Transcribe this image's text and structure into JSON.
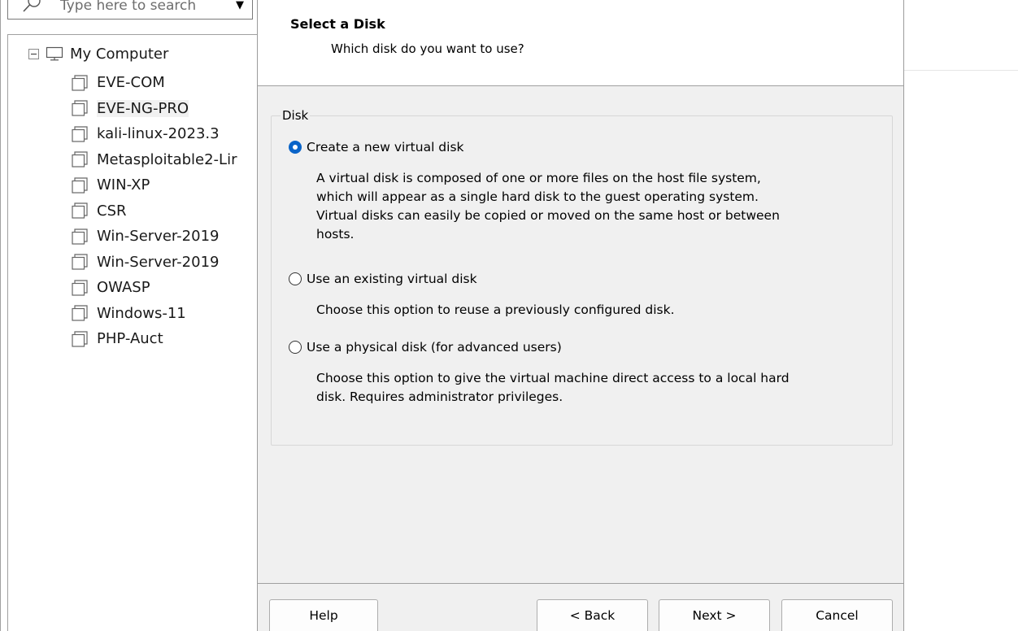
{
  "library": {
    "search_placeholder": "Type here to search",
    "root_label": "My Computer",
    "vms": [
      {
        "name": "EVE-COM"
      },
      {
        "name": "EVE-NG-PRO"
      },
      {
        "name": "kali-linux-2023.3"
      },
      {
        "name": "Metasploitable2-Lir"
      },
      {
        "name": "WIN-XP"
      },
      {
        "name": "CSR"
      },
      {
        "name": "Win-Server-2019"
      },
      {
        "name": "Win-Server-2019"
      },
      {
        "name": "OWASP"
      },
      {
        "name": "Windows-11"
      },
      {
        "name": "PHP-Auct"
      }
    ],
    "selected_index": 1
  },
  "wizard": {
    "title": "Select a Disk",
    "subtitle": "Which disk do you want to use?",
    "group_label": "Disk",
    "options": [
      {
        "label": "Create a new virtual disk",
        "checked": true,
        "desc": [
          "A virtual disk is composed of one or more files on the host file system,",
          "which will appear as a single hard disk to the guest operating system.",
          "Virtual disks can easily be copied or moved on the same host or between",
          "hosts."
        ]
      },
      {
        "label": "Use an existing virtual disk",
        "checked": false,
        "desc": [
          "Choose this option to reuse a previously configured disk."
        ]
      },
      {
        "label": "Use a physical disk (for advanced users)",
        "checked": false,
        "desc": [
          "Choose this option to give the virtual machine direct access to a local hard",
          "disk. Requires administrator privileges."
        ]
      }
    ],
    "buttons": {
      "help": "Help",
      "back": "< Back",
      "next": "Next >",
      "cancel": "Cancel"
    }
  },
  "colors": {
    "accent": "#0a64c8",
    "dialog_bg": "#f0f0f0"
  }
}
